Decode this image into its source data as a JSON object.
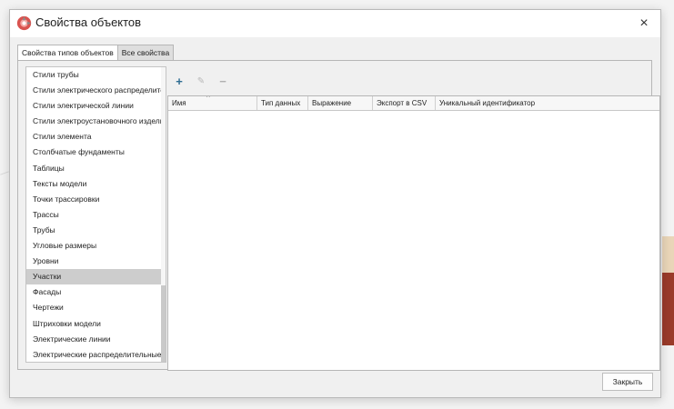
{
  "window": {
    "title": "Свойства объектов",
    "close_icon": "×"
  },
  "tabs": [
    {
      "label": "Свойства типов объектов",
      "active": true
    },
    {
      "label": "Все свойства",
      "active": false
    }
  ],
  "type_list": {
    "items": [
      "Стили трубы",
      "Стили электрического распределительного щита",
      "Стили электрической линии",
      "Стили электроустановочного изделия",
      "Стили элемента",
      "Столбчатые фундаменты",
      "Таблицы",
      "Тексты модели",
      "Точки трассировки",
      "Трассы",
      "Трубы",
      "Угловые размеры",
      "Уровни",
      "Участки",
      "Фасады",
      "Чертежи",
      "Штриховки модели",
      "Электрические линии",
      "Электрические распределительные щиты"
    ],
    "selected": "Участки"
  },
  "toolbar": {
    "add_icon": "+",
    "edit_icon": "✎",
    "remove_icon": "−"
  },
  "grid": {
    "columns": [
      "Имя",
      "Тип данных",
      "Выражение",
      "Экспорт в CSV",
      "Уникальный идентификатор"
    ],
    "sort_icon": "^",
    "rows": []
  },
  "footer": {
    "close_label": "Закрыть"
  }
}
